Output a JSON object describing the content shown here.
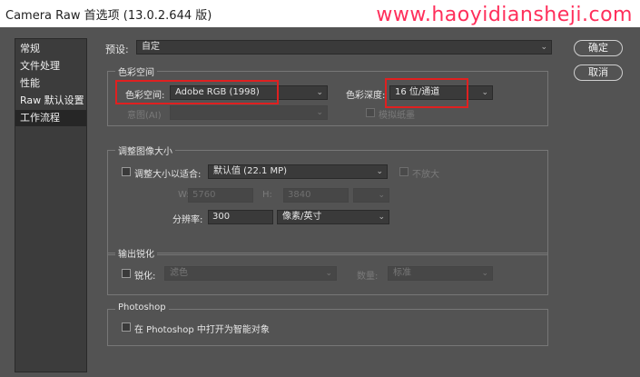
{
  "window": {
    "title": "Camera Raw 首选项  (13.0.2.644 版)"
  },
  "watermark": "www.haoyidiansheji.com",
  "sidebar": {
    "items": [
      {
        "label": "常规"
      },
      {
        "label": "文件处理"
      },
      {
        "label": "性能"
      },
      {
        "label": "Raw 默认设置"
      },
      {
        "label": "工作流程"
      }
    ]
  },
  "preset": {
    "label": "预设:",
    "value": "自定"
  },
  "buttons": {
    "ok": "确定",
    "cancel": "取消"
  },
  "color_space": {
    "title": "色彩空间",
    "space_label": "色彩空间:",
    "space_value": "Adobe RGB (1998)",
    "depth_label": "色彩深度:",
    "depth_value": "16 位/通道",
    "intent_label": "意图(AI)",
    "simulate_label": "模拟纸墨"
  },
  "image_sizing": {
    "title": "调整图像大小",
    "resize_label": "调整大小以适合:",
    "resize_value": "默认值 (22.1 MP)",
    "dont_enlarge_label": "不放大",
    "w_label": "W:",
    "w_value": "5760",
    "h_label": "H:",
    "h_value": "3840",
    "resolution_label": "分辨率:",
    "resolution_value": "300",
    "resolution_unit": "像素/英寸"
  },
  "output_sharpening": {
    "title": "输出锐化",
    "sharpen_label": "锐化:",
    "sharpen_value": "滤色",
    "amount_label": "数量:",
    "amount_value": "标准"
  },
  "photoshop": {
    "title": "Photoshop",
    "smart_object_label": "在 Photoshop 中打开为智能对象"
  },
  "colors": {
    "highlight": "#e02020",
    "watermark": "#ff2f5b"
  }
}
